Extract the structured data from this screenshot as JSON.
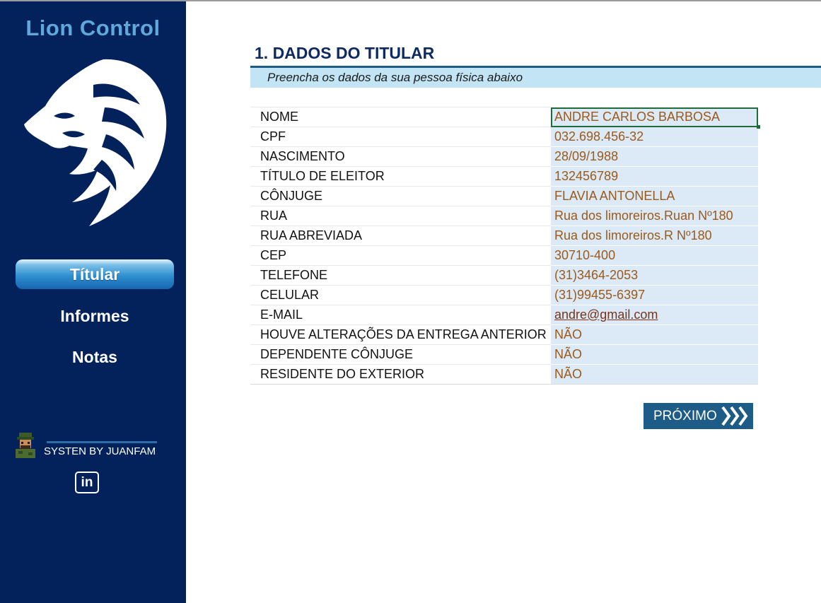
{
  "sidebar": {
    "brand": "Lion Control",
    "nav": [
      "Títular",
      "Informes",
      "Notas"
    ],
    "credit": "SYSTEN BY JUANFAM",
    "linkedin": "in"
  },
  "main": {
    "title": "1. DADOS DO TITULAR",
    "subtitle": "Preencha os dados da sua pessoa física abaixo",
    "fields": [
      {
        "label": "NOME",
        "value": "ANDRE CARLOS BARBOSA"
      },
      {
        "label": "CPF",
        "value": "032.698.456-32"
      },
      {
        "label": "NASCIMENTO",
        "value": "28/09/1988"
      },
      {
        "label": "TÍTULO DE ELEITOR",
        "value": "132456789"
      },
      {
        "label": "CÔNJUGE",
        "value": "FLAVIA ANTONELLA"
      },
      {
        "label": "RUA",
        "value": "Rua dos limoreiros.Ruan Nº180"
      },
      {
        "label": "RUA ABREVIADA",
        "value": "Rua dos limoreiros.R Nº180"
      },
      {
        "label": "CEP",
        "value": "30710-400"
      },
      {
        "label": "TELEFONE",
        "value": "(31)3464-2053"
      },
      {
        "label": "CELULAR",
        "value": "(31)99455-6397"
      },
      {
        "label": "E-MAIL",
        "value": "andre@gmail.com"
      },
      {
        "label": "HOUVE ALTERAÇÕES DA ENTREGA ANTERIOR",
        "value": "NÃO"
      },
      {
        "label": "DEPENDENTE CÔNJUGE",
        "value": "NÃO"
      },
      {
        "label": "RESIDENTE DO EXTERIOR",
        "value": "NÃO"
      }
    ],
    "next_label": "PRÓXIMO"
  },
  "colors": {
    "sidebar_bg": "#03215a",
    "title": "#0e2a62",
    "value_text": "#9b5a19",
    "value_bg": "#dce9f6",
    "button_bg": "#1d5c86"
  },
  "icons": [
    "lion-logo-icon",
    "avatar-icon",
    "linkedin-icon",
    "triple-chevron-right-icon"
  ]
}
